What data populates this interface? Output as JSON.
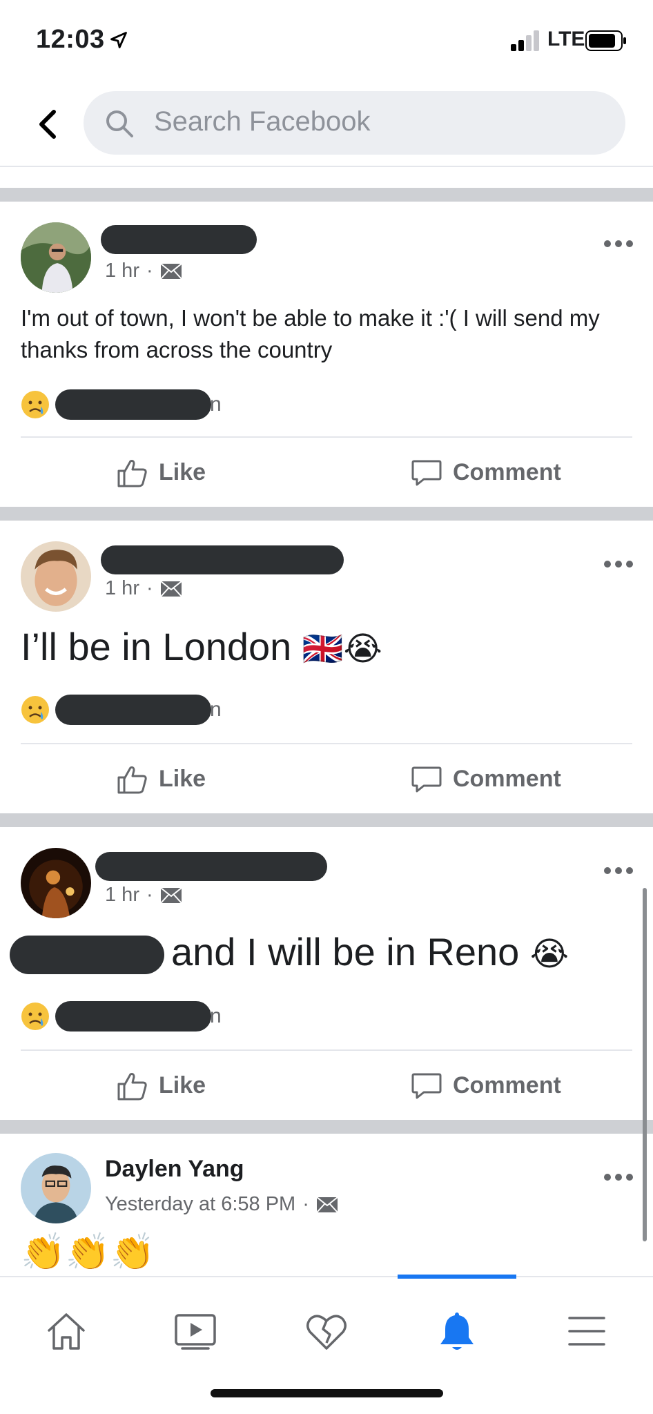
{
  "status_bar": {
    "time": "12:03",
    "network": "LTE"
  },
  "search": {
    "placeholder": "Search Facebook"
  },
  "posts": [
    {
      "time": "1 hr",
      "text": "I'm out of town, I won't be able to make it :'( I will send my thanks from across the country",
      "reaction_tail": "n",
      "like": "Like",
      "comment": "Comment"
    },
    {
      "time": "1 hr",
      "text": "I’ll be in London",
      "emojis": "🇬🇧😭",
      "reaction_tail": "n",
      "like": "Like",
      "comment": "Comment"
    },
    {
      "time": "1 hr",
      "text": "and I will be in Reno",
      "emojis": "😭",
      "reaction_tail": "n",
      "like": "Like",
      "comment": "Comment"
    },
    {
      "name": "Daylen Yang",
      "time": "Yesterday at 6:58 PM",
      "text": "👏👏👏"
    }
  ],
  "nav": {
    "items": [
      "home-icon",
      "watch-icon",
      "dating-icon",
      "notifications-icon",
      "menu-icon"
    ],
    "active": "notifications-icon",
    "active_color": "#1877f2"
  }
}
